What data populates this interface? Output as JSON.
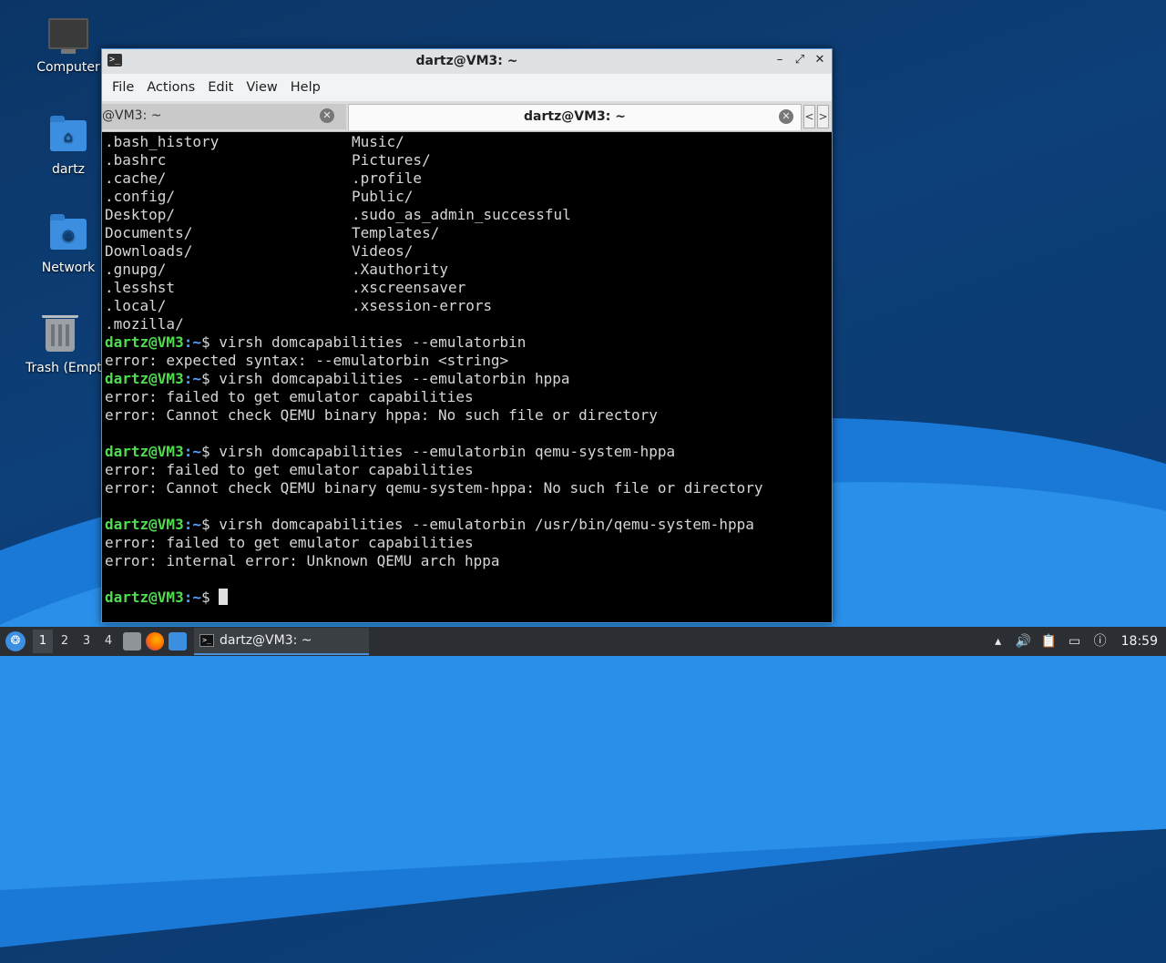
{
  "desktop": {
    "icons": [
      {
        "label": "Computer"
      },
      {
        "label": "dartz"
      },
      {
        "label": "Network"
      },
      {
        "label": "Trash (Empty)"
      }
    ]
  },
  "window": {
    "title": "dartz@VM3: ~",
    "app_icon": ">_",
    "controls": {
      "minimize": "–",
      "maximize": "⤢",
      "close": "✕"
    }
  },
  "menu": [
    "File",
    "Actions",
    "Edit",
    "View",
    "Help"
  ],
  "tabs": [
    {
      "label": "@VM3: ~",
      "close": "✕",
      "active": false
    },
    {
      "label": "dartz@VM3: ~",
      "close": "✕",
      "active": true
    }
  ],
  "tab_scroll": {
    "left": "<",
    "right": ">"
  },
  "terminal": {
    "prompt_user": "dartz@VM3",
    "prompt_path": ":~",
    "prompt_sym": "$",
    "listing_left": [
      ".bash_history",
      ".bashrc",
      ".cache/",
      ".config/",
      "Desktop/",
      "Documents/",
      "Downloads/",
      ".gnupg/",
      ".lesshst",
      ".local/",
      ".mozilla/"
    ],
    "listing_right": [
      "Music/",
      "Pictures/",
      ".profile",
      "Public/",
      ".sudo_as_admin_successful",
      "Templates/",
      "Videos/",
      ".Xauthority",
      ".xscreensaver",
      ".xsession-errors",
      ""
    ],
    "commands": [
      " virsh domcapabilities --emulatorbin",
      " virsh domcapabilities --emulatorbin hppa",
      " virsh domcapabilities --emulatorbin qemu-system-hppa",
      " virsh domcapabilities --emulatorbin /usr/bin/qemu-system-hppa"
    ],
    "outputs": [
      "error: expected syntax: --emulatorbin <string>",
      "error: failed to get emulator capabilities",
      "error: Cannot check QEMU binary hppa: No such file or directory",
      "error: failed to get emulator capabilities",
      "error: Cannot check QEMU binary qemu-system-hppa: No such file or directory",
      "error: failed to get emulator capabilities",
      "error: internal error: Unknown QEMU arch hppa"
    ]
  },
  "taskbar": {
    "workspaces": [
      "1",
      "2",
      "3",
      "4"
    ],
    "task_label": "dartz@VM3: ~",
    "clock": "18:59"
  },
  "colors": {
    "accent": "#4a90d9",
    "prompt_user": "#4fdc4f",
    "prompt_path": "#5aa0ff"
  }
}
